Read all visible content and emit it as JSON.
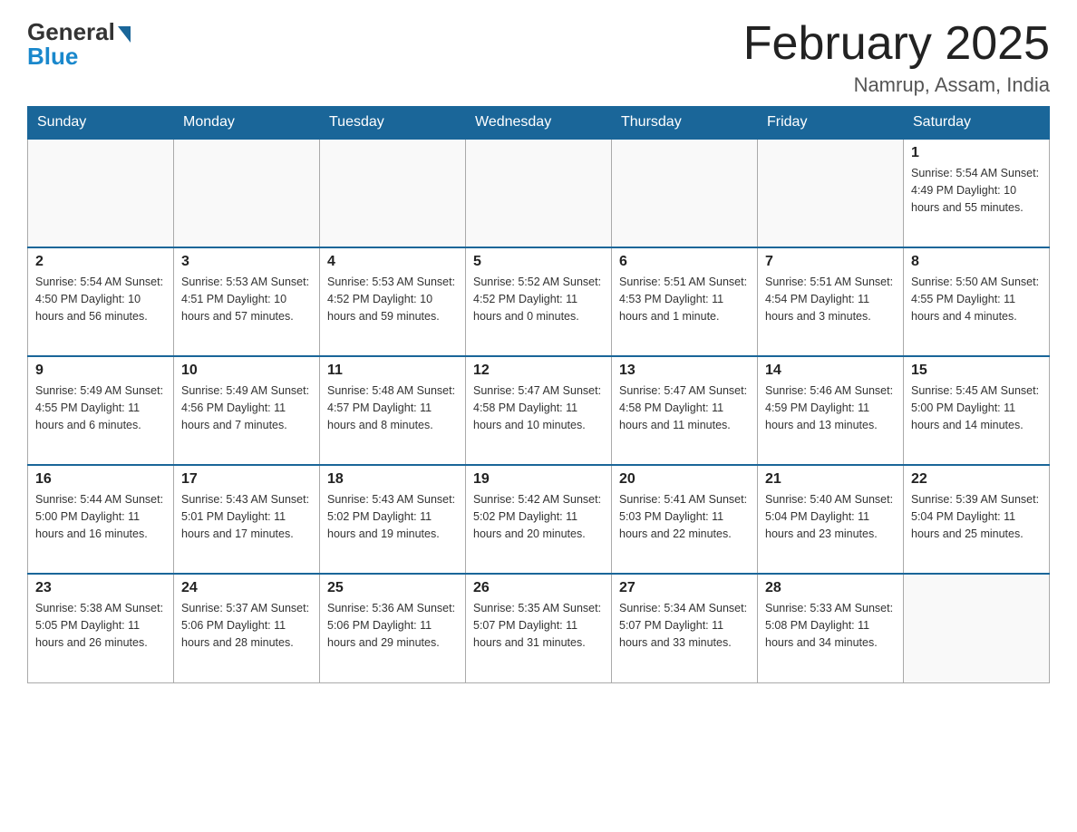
{
  "header": {
    "logo_general": "General",
    "logo_blue": "Blue",
    "month_title": "February 2025",
    "location": "Namrup, Assam, India"
  },
  "weekdays": [
    "Sunday",
    "Monday",
    "Tuesday",
    "Wednesday",
    "Thursday",
    "Friday",
    "Saturday"
  ],
  "weeks": [
    [
      {
        "day": "",
        "info": ""
      },
      {
        "day": "",
        "info": ""
      },
      {
        "day": "",
        "info": ""
      },
      {
        "day": "",
        "info": ""
      },
      {
        "day": "",
        "info": ""
      },
      {
        "day": "",
        "info": ""
      },
      {
        "day": "1",
        "info": "Sunrise: 5:54 AM\nSunset: 4:49 PM\nDaylight: 10 hours\nand 55 minutes."
      }
    ],
    [
      {
        "day": "2",
        "info": "Sunrise: 5:54 AM\nSunset: 4:50 PM\nDaylight: 10 hours\nand 56 minutes."
      },
      {
        "day": "3",
        "info": "Sunrise: 5:53 AM\nSunset: 4:51 PM\nDaylight: 10 hours\nand 57 minutes."
      },
      {
        "day": "4",
        "info": "Sunrise: 5:53 AM\nSunset: 4:52 PM\nDaylight: 10 hours\nand 59 minutes."
      },
      {
        "day": "5",
        "info": "Sunrise: 5:52 AM\nSunset: 4:52 PM\nDaylight: 11 hours\nand 0 minutes."
      },
      {
        "day": "6",
        "info": "Sunrise: 5:51 AM\nSunset: 4:53 PM\nDaylight: 11 hours\nand 1 minute."
      },
      {
        "day": "7",
        "info": "Sunrise: 5:51 AM\nSunset: 4:54 PM\nDaylight: 11 hours\nand 3 minutes."
      },
      {
        "day": "8",
        "info": "Sunrise: 5:50 AM\nSunset: 4:55 PM\nDaylight: 11 hours\nand 4 minutes."
      }
    ],
    [
      {
        "day": "9",
        "info": "Sunrise: 5:49 AM\nSunset: 4:55 PM\nDaylight: 11 hours\nand 6 minutes."
      },
      {
        "day": "10",
        "info": "Sunrise: 5:49 AM\nSunset: 4:56 PM\nDaylight: 11 hours\nand 7 minutes."
      },
      {
        "day": "11",
        "info": "Sunrise: 5:48 AM\nSunset: 4:57 PM\nDaylight: 11 hours\nand 8 minutes."
      },
      {
        "day": "12",
        "info": "Sunrise: 5:47 AM\nSunset: 4:58 PM\nDaylight: 11 hours\nand 10 minutes."
      },
      {
        "day": "13",
        "info": "Sunrise: 5:47 AM\nSunset: 4:58 PM\nDaylight: 11 hours\nand 11 minutes."
      },
      {
        "day": "14",
        "info": "Sunrise: 5:46 AM\nSunset: 4:59 PM\nDaylight: 11 hours\nand 13 minutes."
      },
      {
        "day": "15",
        "info": "Sunrise: 5:45 AM\nSunset: 5:00 PM\nDaylight: 11 hours\nand 14 minutes."
      }
    ],
    [
      {
        "day": "16",
        "info": "Sunrise: 5:44 AM\nSunset: 5:00 PM\nDaylight: 11 hours\nand 16 minutes."
      },
      {
        "day": "17",
        "info": "Sunrise: 5:43 AM\nSunset: 5:01 PM\nDaylight: 11 hours\nand 17 minutes."
      },
      {
        "day": "18",
        "info": "Sunrise: 5:43 AM\nSunset: 5:02 PM\nDaylight: 11 hours\nand 19 minutes."
      },
      {
        "day": "19",
        "info": "Sunrise: 5:42 AM\nSunset: 5:02 PM\nDaylight: 11 hours\nand 20 minutes."
      },
      {
        "day": "20",
        "info": "Sunrise: 5:41 AM\nSunset: 5:03 PM\nDaylight: 11 hours\nand 22 minutes."
      },
      {
        "day": "21",
        "info": "Sunrise: 5:40 AM\nSunset: 5:04 PM\nDaylight: 11 hours\nand 23 minutes."
      },
      {
        "day": "22",
        "info": "Sunrise: 5:39 AM\nSunset: 5:04 PM\nDaylight: 11 hours\nand 25 minutes."
      }
    ],
    [
      {
        "day": "23",
        "info": "Sunrise: 5:38 AM\nSunset: 5:05 PM\nDaylight: 11 hours\nand 26 minutes."
      },
      {
        "day": "24",
        "info": "Sunrise: 5:37 AM\nSunset: 5:06 PM\nDaylight: 11 hours\nand 28 minutes."
      },
      {
        "day": "25",
        "info": "Sunrise: 5:36 AM\nSunset: 5:06 PM\nDaylight: 11 hours\nand 29 minutes."
      },
      {
        "day": "26",
        "info": "Sunrise: 5:35 AM\nSunset: 5:07 PM\nDaylight: 11 hours\nand 31 minutes."
      },
      {
        "day": "27",
        "info": "Sunrise: 5:34 AM\nSunset: 5:07 PM\nDaylight: 11 hours\nand 33 minutes."
      },
      {
        "day": "28",
        "info": "Sunrise: 5:33 AM\nSunset: 5:08 PM\nDaylight: 11 hours\nand 34 minutes."
      },
      {
        "day": "",
        "info": ""
      }
    ]
  ]
}
